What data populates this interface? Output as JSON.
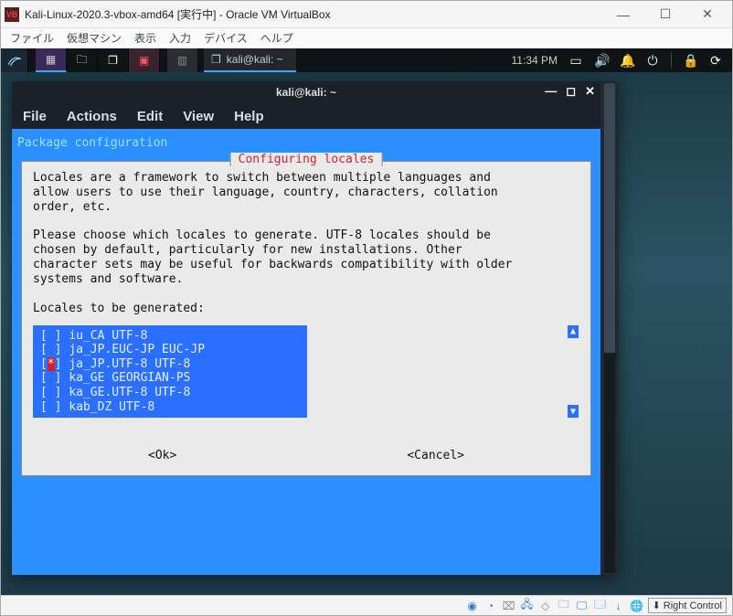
{
  "vbox": {
    "title": "Kali-Linux-2020.3-vbox-amd64 [実行中] - Oracle VM VirtualBox",
    "menu": [
      "ファイル",
      "仮想マシン",
      "表示",
      "入力",
      "デバイス",
      "ヘルプ"
    ],
    "hostkey": "Right Control"
  },
  "kali_taskbar": {
    "task_title": "kali@kali: ~",
    "clock": "11:34 PM"
  },
  "terminal": {
    "title": "kali@kali: ~",
    "menu": [
      "File",
      "Actions",
      "Edit",
      "View",
      "Help"
    ],
    "pkg_header": "Package configuration",
    "dialog_title": "Configuring locales",
    "dialog_text": "Locales are a framework to switch between multiple languages and\nallow users to use their language, country, characters, collation\norder, etc.\n\nPlease choose which locales to generate. UTF-8 locales should be\nchosen by default, particularly for new installations. Other\ncharacter sets may be useful for backwards compatibility with older\nsystems and software.\n\nLocales to be generated:",
    "locales": [
      {
        "sel": " ",
        "label": "iu_CA UTF-8"
      },
      {
        "sel": " ",
        "label": "ja_JP.EUC-JP EUC-JP"
      },
      {
        "sel": "*",
        "label": "ja_JP.UTF-8 UTF-8"
      },
      {
        "sel": " ",
        "label": "ka_GE GEORGIAN-PS"
      },
      {
        "sel": " ",
        "label": "ka_GE.UTF-8 UTF-8"
      },
      {
        "sel": " ",
        "label": "kab_DZ UTF-8"
      }
    ],
    "ok": "<Ok>",
    "cancel": "<Cancel>"
  }
}
